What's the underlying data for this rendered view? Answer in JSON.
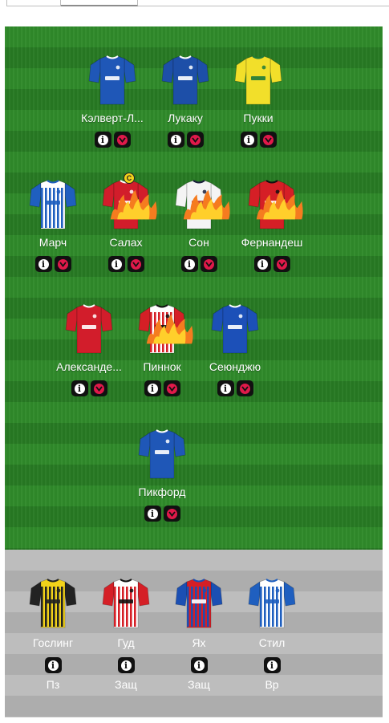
{
  "colors": {
    "info_button_bg": "#111111",
    "remove_button_accent": "#e0194a",
    "captain_badge": "#f2d21a",
    "pitch_green": "#2f8a2a",
    "bench_grey": "#bdbdbd"
  },
  "captain_badge": {
    "label": "C",
    "player": "Салах"
  },
  "pitch": {
    "forwards": [
      {
        "name": "Кэлверт-Л...",
        "shirt": "everton-shirt-icon"
      },
      {
        "name": "Лукаку",
        "shirt": "chelsea-shirt-icon"
      },
      {
        "name": "Пукки",
        "shirt": "norwich-shirt-icon"
      }
    ],
    "midfielders": [
      {
        "name": "Марч",
        "shirt": "brighton-shirt-icon"
      },
      {
        "name": "Салах",
        "shirt": "liverpool-shirt-icon",
        "on_fire": true
      },
      {
        "name": "Сон",
        "shirt": "tottenham-shirt-icon",
        "on_fire": true
      },
      {
        "name": "Фернандеш",
        "shirt": "man-utd-shirt-icon",
        "on_fire": true
      }
    ],
    "defenders": [
      {
        "name": "Александе...",
        "shirt": "liverpool-shirt-icon"
      },
      {
        "name": "Пиннок",
        "shirt": "brentford-shirt-icon",
        "on_fire": true
      },
      {
        "name": "Сеюнджю",
        "shirt": "leicester-shirt-icon"
      }
    ],
    "goalkeeper": {
      "name": "Пикфорд",
      "shirt": "everton-shirt-icon"
    }
  },
  "bench": [
    {
      "name": "Гослинг",
      "position": "Пз",
      "shirt": "watford-shirt-icon"
    },
    {
      "name": "Гуд",
      "position": "Защ",
      "shirt": "brentford-shirt-icon"
    },
    {
      "name": "Ях",
      "position": "Защ",
      "shirt": "crystal-palace-shirt-icon"
    },
    {
      "name": "Стил",
      "position": "Вр",
      "shirt": "brighton-shirt-icon"
    }
  ],
  "buttons": {
    "info_symbol": "i",
    "remove_symbol": "chevron-down-icon"
  }
}
